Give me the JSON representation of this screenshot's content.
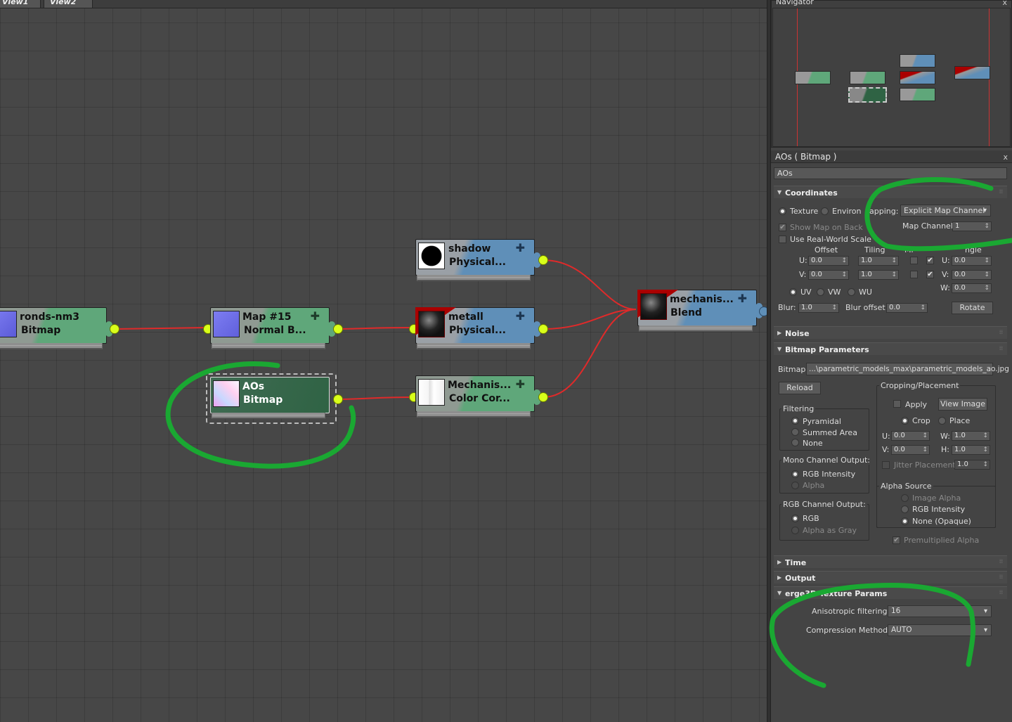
{
  "views": {
    "tab1": "View1",
    "tab2": "View2"
  },
  "nodes": [
    {
      "id": "ronds",
      "name": "ronds-nm3",
      "type": "Bitmap"
    },
    {
      "id": "map15",
      "name": "Map #15",
      "type": "Normal B..."
    },
    {
      "id": "shadow",
      "name": "shadow",
      "type": "Physical..."
    },
    {
      "id": "metall",
      "name": "metall",
      "type": "Physical..."
    },
    {
      "id": "aos",
      "name": "AOs",
      "type": "Bitmap"
    },
    {
      "id": "mechcolor",
      "name": "Mechanis...",
      "type": "Color Cor..."
    },
    {
      "id": "blend",
      "name": "mechanis...",
      "type": "Blend"
    }
  ],
  "navigator": {
    "title": "Navigator",
    "close": "x"
  },
  "panel": {
    "title": "AOs  ( Bitmap )",
    "close": "x",
    "name": "AOs",
    "coordinates": {
      "title": "Coordinates",
      "texture": "Texture",
      "environ": "Environ",
      "mapping_label": "apping:",
      "mapping_value": "Explicit Map Channel",
      "show_map_on_back": "Show Map on Back",
      "map_channel_label": "Map Channel:",
      "map_channel_value": "1",
      "real_world": "Use Real-World Scale",
      "offset": "Offset",
      "tiling": "Tiling",
      "angle": "ngle",
      "mirror": "Mi",
      "u": "U:",
      "v": "V:",
      "w": "W:",
      "off_u": "0.0",
      "off_v": "0.0",
      "til_u": "1.0",
      "til_v": "1.0",
      "ang_u": "0.0",
      "ang_v": "0.0",
      "ang_w": "0.0",
      "uv": "UV",
      "vw": "VW",
      "wu": "WU",
      "blur_label": "Blur:",
      "blur": "1.0",
      "blur_off_label": "Blur offset:",
      "blur_off": "0.0",
      "rotate": "Rotate"
    },
    "noise": "Noise",
    "bitmap_params": {
      "title": "Bitmap Parameters",
      "bitmap_label": "Bitmap:",
      "bitmap_path": "...\\parametric_models_max\\parametric_models_ao.jpg",
      "reload": "Reload",
      "cropping": "Cropping/Placement",
      "apply": "Apply",
      "view_image": "View Image",
      "crop": "Crop",
      "place": "Place",
      "u": "U:",
      "v": "V:",
      "w": "W:",
      "h": "H:",
      "cu": "0.0",
      "cv": "0.0",
      "cw": "1.0",
      "ch": "1.0",
      "jitter": "Jitter Placement:",
      "jitter_val": "1.0",
      "filtering": "Filtering",
      "pyramidal": "Pyramidal",
      "summed": "Summed Area",
      "none": "None",
      "mono": "Mono Channel Output:",
      "rgb_intensity": "RGB Intensity",
      "alpha": "Alpha",
      "rgb_out": "RGB Channel Output:",
      "rgb": "RGB",
      "alpha_gray": "Alpha as Gray",
      "alpha_source": "Alpha Source",
      "image_alpha": "Image Alpha",
      "rgb_int2": "RGB Intensity",
      "none_opaque": "None (Opaque)",
      "premult": "Premultiplied Alpha"
    },
    "time": "Time",
    "output": "Output",
    "verge": {
      "title": "erge3D Texture Params",
      "aniso_label": "Anisotropic filtering:",
      "aniso": "16",
      "comp_label": "Compression Method:",
      "comp": "AUTO"
    }
  }
}
